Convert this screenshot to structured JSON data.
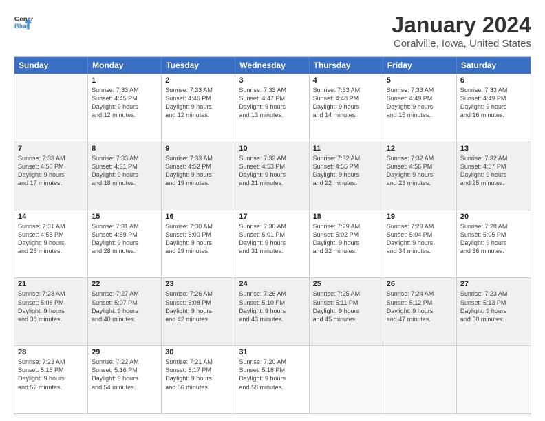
{
  "header": {
    "logo_line1": "General",
    "logo_line2": "Blue",
    "main_title": "January 2024",
    "subtitle": "Coralville, Iowa, United States"
  },
  "weekdays": [
    "Sunday",
    "Monday",
    "Tuesday",
    "Wednesday",
    "Thursday",
    "Friday",
    "Saturday"
  ],
  "weeks": [
    [
      {
        "day": "",
        "info": "",
        "empty": true
      },
      {
        "day": "1",
        "info": "Sunrise: 7:33 AM\nSunset: 4:45 PM\nDaylight: 9 hours\nand 12 minutes."
      },
      {
        "day": "2",
        "info": "Sunrise: 7:33 AM\nSunset: 4:46 PM\nDaylight: 9 hours\nand 12 minutes."
      },
      {
        "day": "3",
        "info": "Sunrise: 7:33 AM\nSunset: 4:47 PM\nDaylight: 9 hours\nand 13 minutes."
      },
      {
        "day": "4",
        "info": "Sunrise: 7:33 AM\nSunset: 4:48 PM\nDaylight: 9 hours\nand 14 minutes."
      },
      {
        "day": "5",
        "info": "Sunrise: 7:33 AM\nSunset: 4:49 PM\nDaylight: 9 hours\nand 15 minutes."
      },
      {
        "day": "6",
        "info": "Sunrise: 7:33 AM\nSunset: 4:49 PM\nDaylight: 9 hours\nand 16 minutes."
      }
    ],
    [
      {
        "day": "7",
        "info": "Sunrise: 7:33 AM\nSunset: 4:50 PM\nDaylight: 9 hours\nand 17 minutes.",
        "shaded": true
      },
      {
        "day": "8",
        "info": "Sunrise: 7:33 AM\nSunset: 4:51 PM\nDaylight: 9 hours\nand 18 minutes.",
        "shaded": true
      },
      {
        "day": "9",
        "info": "Sunrise: 7:33 AM\nSunset: 4:52 PM\nDaylight: 9 hours\nand 19 minutes.",
        "shaded": true
      },
      {
        "day": "10",
        "info": "Sunrise: 7:32 AM\nSunset: 4:53 PM\nDaylight: 9 hours\nand 21 minutes.",
        "shaded": true
      },
      {
        "day": "11",
        "info": "Sunrise: 7:32 AM\nSunset: 4:55 PM\nDaylight: 9 hours\nand 22 minutes.",
        "shaded": true
      },
      {
        "day": "12",
        "info": "Sunrise: 7:32 AM\nSunset: 4:56 PM\nDaylight: 9 hours\nand 23 minutes.",
        "shaded": true
      },
      {
        "day": "13",
        "info": "Sunrise: 7:32 AM\nSunset: 4:57 PM\nDaylight: 9 hours\nand 25 minutes.",
        "shaded": true
      }
    ],
    [
      {
        "day": "14",
        "info": "Sunrise: 7:31 AM\nSunset: 4:58 PM\nDaylight: 9 hours\nand 26 minutes."
      },
      {
        "day": "15",
        "info": "Sunrise: 7:31 AM\nSunset: 4:59 PM\nDaylight: 9 hours\nand 28 minutes."
      },
      {
        "day": "16",
        "info": "Sunrise: 7:30 AM\nSunset: 5:00 PM\nDaylight: 9 hours\nand 29 minutes."
      },
      {
        "day": "17",
        "info": "Sunrise: 7:30 AM\nSunset: 5:01 PM\nDaylight: 9 hours\nand 31 minutes."
      },
      {
        "day": "18",
        "info": "Sunrise: 7:29 AM\nSunset: 5:02 PM\nDaylight: 9 hours\nand 32 minutes."
      },
      {
        "day": "19",
        "info": "Sunrise: 7:29 AM\nSunset: 5:04 PM\nDaylight: 9 hours\nand 34 minutes."
      },
      {
        "day": "20",
        "info": "Sunrise: 7:28 AM\nSunset: 5:05 PM\nDaylight: 9 hours\nand 36 minutes."
      }
    ],
    [
      {
        "day": "21",
        "info": "Sunrise: 7:28 AM\nSunset: 5:06 PM\nDaylight: 9 hours\nand 38 minutes.",
        "shaded": true
      },
      {
        "day": "22",
        "info": "Sunrise: 7:27 AM\nSunset: 5:07 PM\nDaylight: 9 hours\nand 40 minutes.",
        "shaded": true
      },
      {
        "day": "23",
        "info": "Sunrise: 7:26 AM\nSunset: 5:08 PM\nDaylight: 9 hours\nand 42 minutes.",
        "shaded": true
      },
      {
        "day": "24",
        "info": "Sunrise: 7:26 AM\nSunset: 5:10 PM\nDaylight: 9 hours\nand 43 minutes.",
        "shaded": true
      },
      {
        "day": "25",
        "info": "Sunrise: 7:25 AM\nSunset: 5:11 PM\nDaylight: 9 hours\nand 45 minutes.",
        "shaded": true
      },
      {
        "day": "26",
        "info": "Sunrise: 7:24 AM\nSunset: 5:12 PM\nDaylight: 9 hours\nand 47 minutes.",
        "shaded": true
      },
      {
        "day": "27",
        "info": "Sunrise: 7:23 AM\nSunset: 5:13 PM\nDaylight: 9 hours\nand 50 minutes.",
        "shaded": true
      }
    ],
    [
      {
        "day": "28",
        "info": "Sunrise: 7:23 AM\nSunset: 5:15 PM\nDaylight: 9 hours\nand 52 minutes."
      },
      {
        "day": "29",
        "info": "Sunrise: 7:22 AM\nSunset: 5:16 PM\nDaylight: 9 hours\nand 54 minutes."
      },
      {
        "day": "30",
        "info": "Sunrise: 7:21 AM\nSunset: 5:17 PM\nDaylight: 9 hours\nand 56 minutes."
      },
      {
        "day": "31",
        "info": "Sunrise: 7:20 AM\nSunset: 5:18 PM\nDaylight: 9 hours\nand 58 minutes."
      },
      {
        "day": "",
        "info": "",
        "empty": true
      },
      {
        "day": "",
        "info": "",
        "empty": true
      },
      {
        "day": "",
        "info": "",
        "empty": true
      }
    ]
  ]
}
